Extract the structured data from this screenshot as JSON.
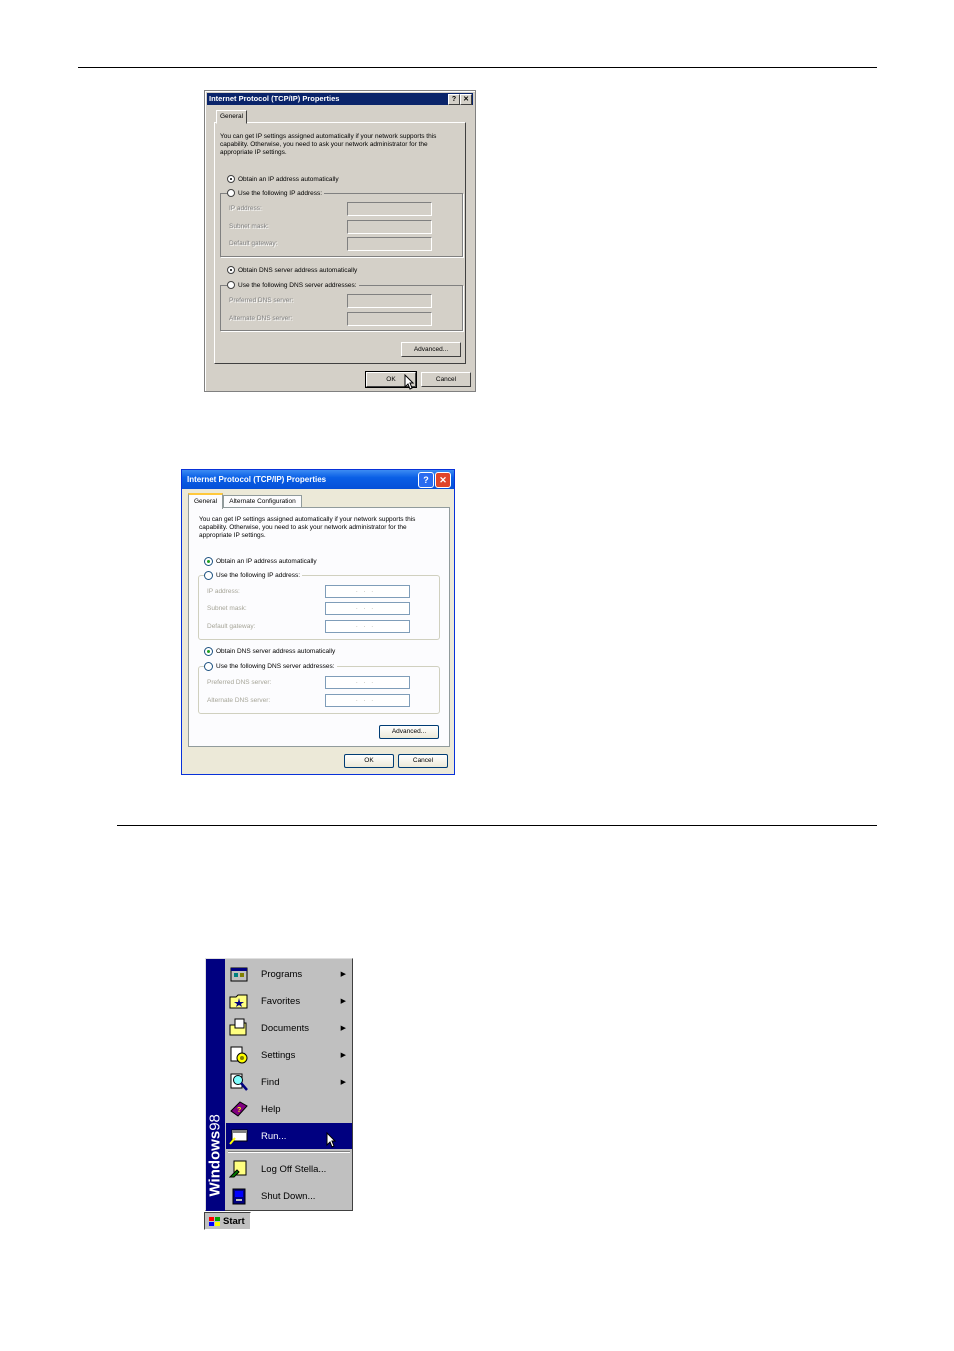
{
  "w2k_dialog": {
    "title": "Internet Protocol (TCP/IP) Properties",
    "help_button": "?",
    "close_button": "✕",
    "tab": "General",
    "description": "You can get IP settings assigned automatically if your network supports this capability. Otherwise, you need to ask your network administrator for the appropriate IP settings.",
    "radio_obtain_ip": "Obtain an IP address automatically",
    "radio_use_ip": "Use the following IP address:",
    "ip_address_label": "IP address:",
    "subnet_mask_label": "Subnet mask:",
    "default_gateway_label": "Default gateway:",
    "radio_obtain_dns": "Obtain DNS server address automatically",
    "radio_use_dns": "Use the following DNS server addresses:",
    "preferred_dns_label": "Preferred DNS server:",
    "alternate_dns_label": "Alternate DNS server:",
    "advanced_button": "Advanced...",
    "ok_button": "OK",
    "cancel_button": "Cancel"
  },
  "xp_dialog": {
    "title": "Internet Protocol (TCP/IP) Properties",
    "help_button": "?",
    "close_button": "✕",
    "tab_general": "General",
    "tab_alternate": "Alternate Configuration",
    "description": "You can get IP settings assigned automatically if your network supports this capability. Otherwise, you need to ask your network administrator for the appropriate IP settings.",
    "radio_obtain_ip": "Obtain an IP address automatically",
    "radio_use_ip": "Use the following IP address:",
    "ip_address_label": "IP address:",
    "subnet_mask_label": "Subnet mask:",
    "default_gateway_label": "Default gateway:",
    "radio_obtain_dns": "Obtain DNS server address automatically",
    "radio_use_dns": "Use the following DNS server addresses:",
    "preferred_dns_label": "Preferred DNS server:",
    "alternate_dns_label": "Alternate DNS server:",
    "field_dots": "...",
    "advanced_button": "Advanced...",
    "ok_button": "OK",
    "cancel_button": "Cancel"
  },
  "start_menu": {
    "band_bold": "Windows",
    "band_light": "98",
    "items": [
      {
        "label": "Programs",
        "icon": "programs-icon",
        "submenu": true
      },
      {
        "label": "Favorites",
        "icon": "favorites-icon",
        "submenu": true
      },
      {
        "label": "Documents",
        "icon": "documents-icon",
        "submenu": true
      },
      {
        "label": "Settings",
        "icon": "settings-icon",
        "submenu": true
      },
      {
        "label": "Find",
        "icon": "find-icon",
        "submenu": true
      },
      {
        "label": "Help",
        "icon": "help-icon",
        "submenu": false
      },
      {
        "label": "Run...",
        "icon": "run-icon",
        "submenu": false,
        "highlighted": true
      },
      {
        "label": "Log Off Stella...",
        "icon": "log-off-icon",
        "submenu": false
      },
      {
        "label": "Shut Down...",
        "icon": "shut-down-icon",
        "submenu": false
      }
    ],
    "submenu_arrow": "▶",
    "start_button": "Start"
  },
  "colors": {
    "w2k_titlebar": "#0a246a",
    "xp_titlebar": "#0550d8",
    "menu_highlight": "#000080"
  }
}
